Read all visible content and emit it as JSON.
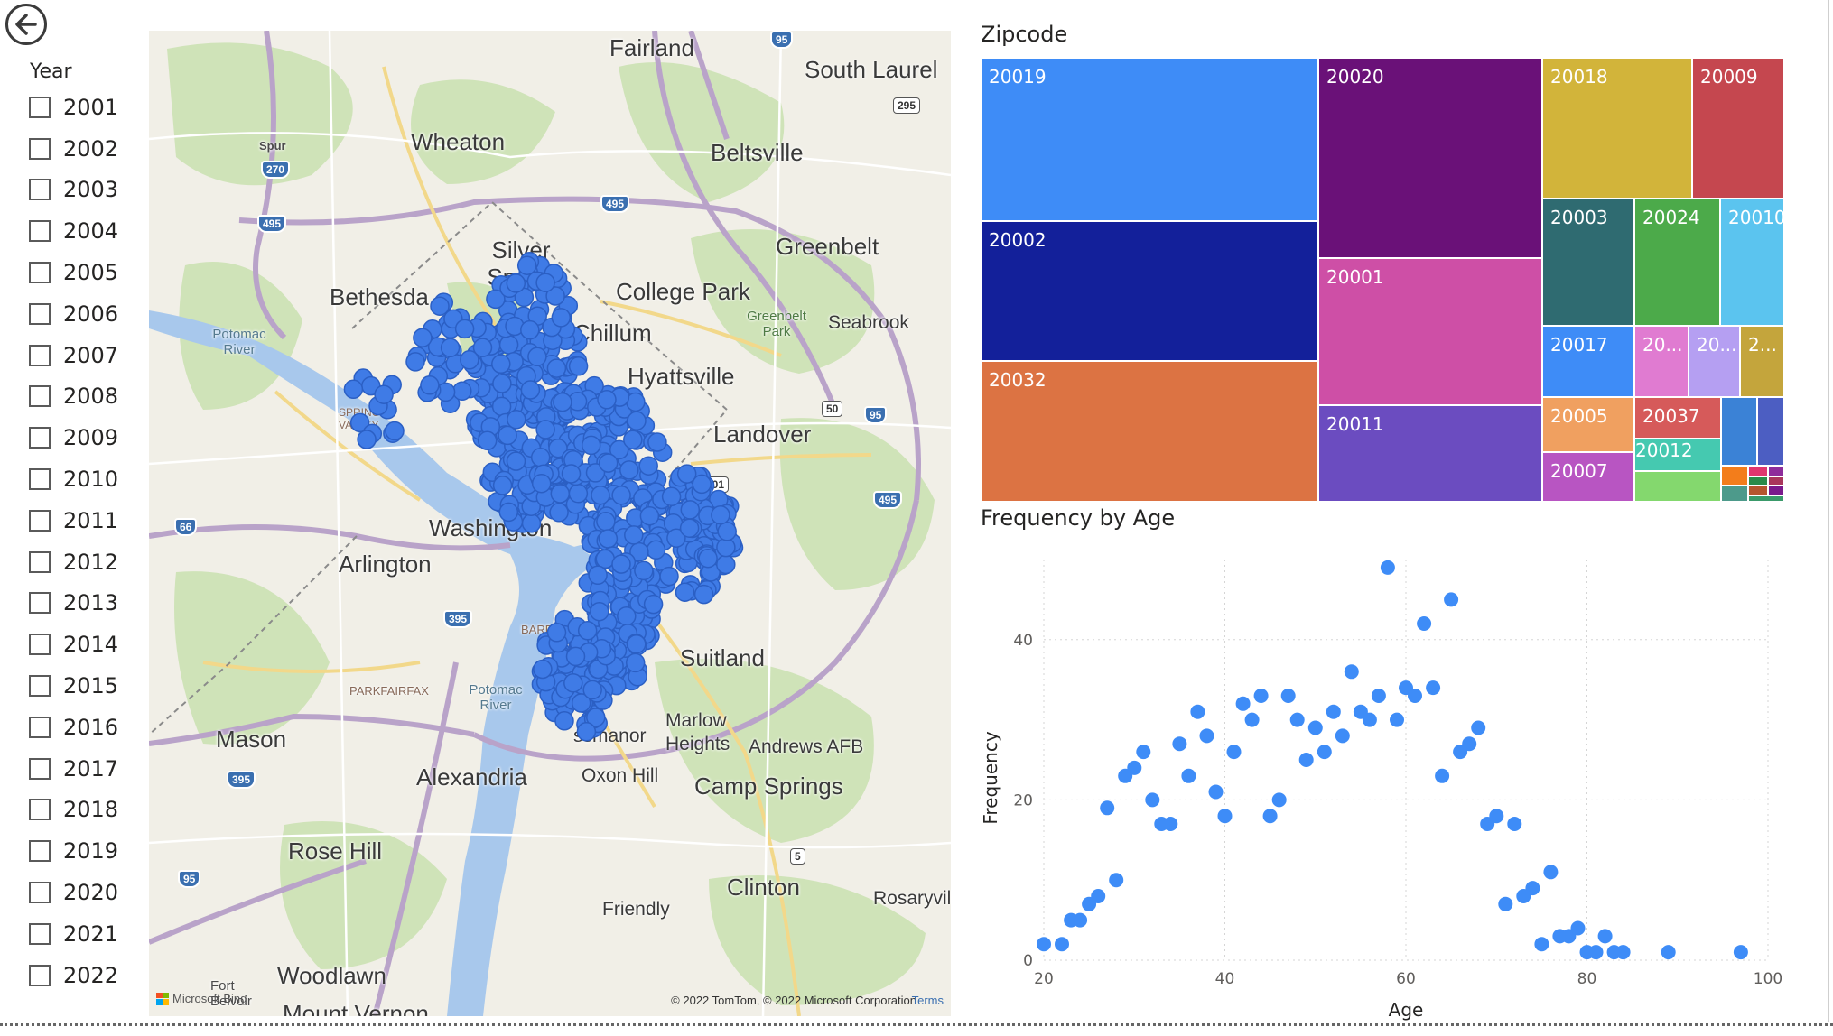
{
  "slicer": {
    "title": "Year",
    "items": [
      "2001",
      "2002",
      "2003",
      "2004",
      "2005",
      "2006",
      "2007",
      "2008",
      "2009",
      "2010",
      "2011",
      "2012",
      "2013",
      "2014",
      "2015",
      "2016",
      "2017",
      "2018",
      "2019",
      "2020",
      "2021",
      "2022"
    ]
  },
  "map": {
    "labels": {
      "fairland": "Fairland",
      "south_laurel": "South Laurel",
      "wheaton": "Wheaton",
      "beltsville": "Beltsville",
      "spur": "Spur",
      "silver_spring": "Silver Spring",
      "greenbelt": "Greenbelt",
      "bethesda": "Bethesda",
      "college_park": "College Park",
      "chillum": "Chillum",
      "greenbelt_park": "Greenbelt Park",
      "seabrook": "Seabrook",
      "potomac_river": "Potomac River",
      "hyattsville": "Hyattsville",
      "spring_valley": "SPRING VALLEY",
      "landover": "Landover",
      "arlington": "Arlington",
      "washington": "Washington",
      "barry_farm": "BARRY F",
      "suitland": "Suitland",
      "parkfairfax": "PARKFAIRFAX",
      "potomac_river2": "Potomac River",
      "mason": "Mason",
      "marlow_heights": "Marlow Heights",
      "hillcrest": "ssmanor",
      "andrews_afb": "Andrews AFB",
      "alexandria": "Alexandria",
      "oxon_hill": "Oxon Hill",
      "camp_springs": "Camp Springs",
      "rose_hill": "Rose Hill",
      "clinton": "Clinton",
      "friendly": "Friendly",
      "rosaryville": "Rosaryvil",
      "woodlawn": "Woodlawn",
      "fort_belvoir": "Fort Belvoir",
      "mount_vernon": "Mount Vernon"
    },
    "shields": {
      "i95_top": "95",
      "r295": "295",
      "r270": "270",
      "i495_a": "495",
      "i495_b": "495",
      "i66": "66",
      "r50": "50",
      "i95_b": "95",
      "i395_a": "395",
      "i395_b": "395",
      "i495_c": "495",
      "r5": "5",
      "i95_c": "95",
      "r201": "201"
    },
    "copyright": "© 2022 TomTom, © 2022 Microsoft Corporation",
    "terms": "Terms",
    "ms_bing": "Microsoft Bing"
  },
  "treemap": {
    "title": "Zipcode",
    "tiles": [
      {
        "label": "20019",
        "color": "#3e8cf7"
      },
      {
        "label": "20002",
        "color": "#13209a"
      },
      {
        "label": "20032",
        "color": "#dc7343"
      },
      {
        "label": "20020",
        "color": "#6a1178"
      },
      {
        "label": "20001",
        "color": "#ce4fa6"
      },
      {
        "label": "20011",
        "color": "#6b4cc0"
      },
      {
        "label": "20018",
        "color": "#d2b43a"
      },
      {
        "label": "20009",
        "color": "#c5474f"
      },
      {
        "label": "20003",
        "color": "#2f6b71"
      },
      {
        "label": "20024",
        "color": "#4caa4a"
      },
      {
        "label": "20010",
        "color": "#5bc4ef"
      },
      {
        "label": "20017",
        "color": "#3e8cf7"
      },
      {
        "label": "20...",
        "color": "#e07bd1"
      },
      {
        "label": "20...",
        "color": "#b59ff2"
      },
      {
        "label": "2...",
        "color": "#c4a53c"
      },
      {
        "label": "20005",
        "color": "#f0a060"
      },
      {
        "label": "20037",
        "color": "#d65a5a"
      },
      {
        "label": "20007",
        "color": "#b855c2"
      },
      {
        "label": "20012",
        "color": "#45c9b0"
      },
      {
        "label": "",
        "color": "#84d86e"
      },
      {
        "label": "",
        "color": "#3b82d6"
      },
      {
        "label": "",
        "color": "#4c5ec2"
      },
      {
        "label": "",
        "color": "#f37d1b"
      },
      {
        "label": "",
        "color": "#e0356f"
      },
      {
        "label": "",
        "color": "#8e2c9b"
      },
      {
        "label": "",
        "color": "#2a8a4a"
      },
      {
        "label": "",
        "color": "#a9365c"
      },
      {
        "label": "",
        "color": "#4d9a8b"
      },
      {
        "label": "",
        "color": "#b5552f"
      },
      {
        "label": "",
        "color": "#7a1a8c"
      },
      {
        "label": "",
        "color": "#3a9a6a"
      }
    ]
  },
  "chart_data": {
    "type": "scatter",
    "title": "Frequency by Age",
    "xlabel": "Age",
    "ylabel": "Frequency",
    "xlim": [
      20,
      100
    ],
    "ylim": [
      0,
      50
    ],
    "xticks": [
      "20",
      "40",
      "60",
      "80",
      "100"
    ],
    "yticks": [
      "0",
      "20",
      "40"
    ],
    "grid": true,
    "color": "#3e8cf7",
    "points": [
      [
        20,
        2
      ],
      [
        22,
        2
      ],
      [
        23,
        5
      ],
      [
        24,
        5
      ],
      [
        25,
        7
      ],
      [
        26,
        8
      ],
      [
        27,
        19
      ],
      [
        28,
        10
      ],
      [
        29,
        23
      ],
      [
        30,
        24
      ],
      [
        31,
        26
      ],
      [
        32,
        20
      ],
      [
        33,
        17
      ],
      [
        34,
        17
      ],
      [
        35,
        27
      ],
      [
        36,
        23
      ],
      [
        37,
        31
      ],
      [
        38,
        28
      ],
      [
        39,
        21
      ],
      [
        40,
        18
      ],
      [
        41,
        26
      ],
      [
        42,
        32
      ],
      [
        43,
        30
      ],
      [
        44,
        33
      ],
      [
        45,
        18
      ],
      [
        46,
        20
      ],
      [
        47,
        33
      ],
      [
        48,
        30
      ],
      [
        49,
        25
      ],
      [
        50,
        29
      ],
      [
        51,
        26
      ],
      [
        52,
        31
      ],
      [
        53,
        28
      ],
      [
        54,
        36
      ],
      [
        55,
        31
      ],
      [
        56,
        30
      ],
      [
        57,
        33
      ],
      [
        58,
        49
      ],
      [
        59,
        30
      ],
      [
        60,
        34
      ],
      [
        61,
        33
      ],
      [
        62,
        42
      ],
      [
        63,
        34
      ],
      [
        64,
        23
      ],
      [
        65,
        45
      ],
      [
        66,
        26
      ],
      [
        67,
        27
      ],
      [
        68,
        29
      ],
      [
        69,
        17
      ],
      [
        70,
        18
      ],
      [
        71,
        7
      ],
      [
        72,
        17
      ],
      [
        73,
        8
      ],
      [
        74,
        9
      ],
      [
        75,
        2
      ],
      [
        76,
        11
      ],
      [
        77,
        3
      ],
      [
        78,
        3
      ],
      [
        79,
        4
      ],
      [
        80,
        1
      ],
      [
        81,
        1
      ],
      [
        82,
        3
      ],
      [
        83,
        1
      ],
      [
        84,
        1
      ],
      [
        89,
        1
      ],
      [
        97,
        1
      ]
    ]
  }
}
